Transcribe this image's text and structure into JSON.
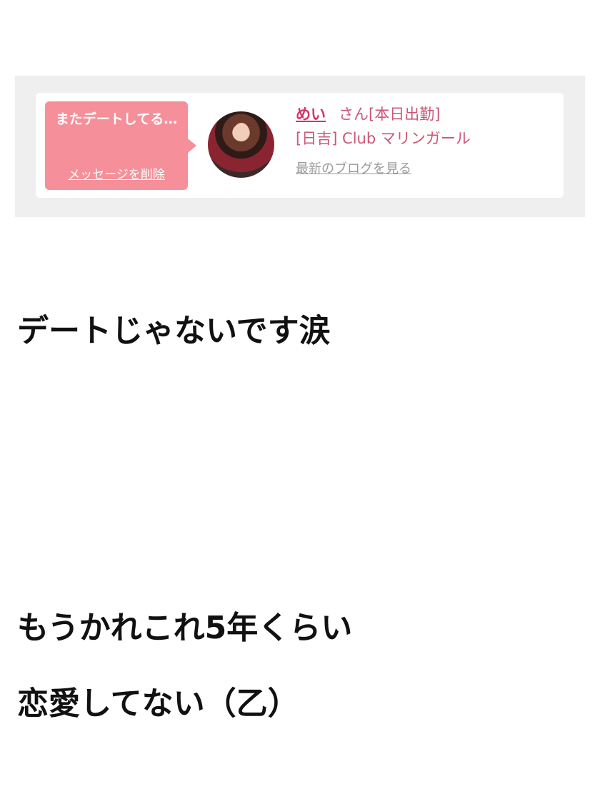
{
  "message_card": {
    "bubble_text": "またデートしてる…",
    "delete_link": "メッセージを削除",
    "cast_name": "めい",
    "name_suffix": "さん[本日出勤]",
    "shop": "[日吉] Club マリンガール",
    "blog_link": "最新のブログを見る",
    "avatar_icon": "profile-photo",
    "accent_color": "#f5909a"
  },
  "body_text": {
    "line1": "デートじゃないです涙",
    "line2": "もうかれこれ5年くらい",
    "line3": "恋愛してない（乙）"
  }
}
